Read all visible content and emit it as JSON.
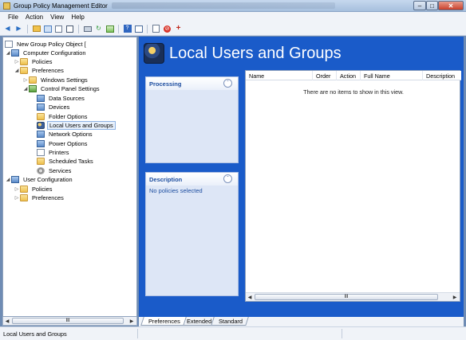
{
  "window": {
    "title": "Group Policy Management Editor"
  },
  "menu": [
    "File",
    "Action",
    "View",
    "Help"
  ],
  "toolbar": {
    "icons": [
      "back-icon",
      "forward-icon",
      "up-folder-icon",
      "show-tree-icon",
      "copy-icon",
      "paste-icon",
      "print-icon",
      "refresh-icon",
      "export-icon",
      "help-icon",
      "properties-icon",
      "new-item-icon",
      "stop-icon",
      "add-icon"
    ]
  },
  "tree": {
    "root": "New Group Policy Object [",
    "computer_config": "Computer Configuration",
    "policies": "Policies",
    "preferences": "Preferences",
    "windows_settings": "Windows Settings",
    "control_panel_settings": "Control Panel Settings",
    "cps_items": [
      "Data Sources",
      "Devices",
      "Folder Options",
      "Local Users and Groups",
      "Network Options",
      "Power Options",
      "Printers",
      "Scheduled Tasks",
      "Services"
    ],
    "selected": "Local Users and Groups",
    "user_config": "User Configuration",
    "user_policies": "Policies",
    "user_preferences": "Preferences",
    "scroll_thumb": "III"
  },
  "content": {
    "heading": "Local Users and Groups",
    "processing": {
      "title": "Processing",
      "text": ""
    },
    "description": {
      "title": "Description",
      "text": "No policies selected"
    },
    "columns": [
      "Name",
      "Order",
      "Action",
      "Full Name",
      "Description"
    ],
    "empty_message": "There are no items to show in this view.",
    "scroll_thumb": "III"
  },
  "tabs": [
    "Preferences",
    "Extended",
    "Standard"
  ],
  "active_tab": "Preferences",
  "status": {
    "text": "Local Users and Groups"
  },
  "colors": {
    "accent": "#1a5bc9",
    "panel_bg": "#dde6f6",
    "panel_title": "#1b4c9f"
  }
}
